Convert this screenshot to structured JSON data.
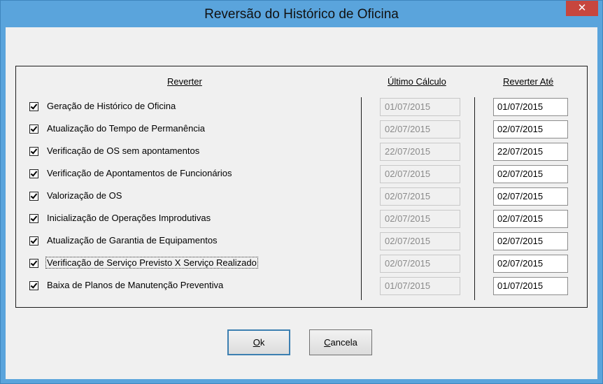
{
  "window": {
    "title": "Reversão do Histórico de Oficina",
    "close_label": "✕"
  },
  "columns": {
    "reverter": "Reverter",
    "ultimo_calculo": "Último Cálculo",
    "reverter_ate": "Reverter Até"
  },
  "rows": [
    {
      "label": "Geração de Histórico de Oficina",
      "checked": true,
      "ultimo_calculo": "01/07/2015",
      "reverter_ate": "01/07/2015"
    },
    {
      "label": "Atualização do Tempo de Permanência",
      "checked": true,
      "ultimo_calculo": "02/07/2015",
      "reverter_ate": "02/07/2015"
    },
    {
      "label": "Verificação de OS sem apontamentos",
      "checked": true,
      "ultimo_calculo": "22/07/2015",
      "reverter_ate": "22/07/2015"
    },
    {
      "label": "Verificação de Apontamentos de Funcionários",
      "checked": true,
      "ultimo_calculo": "02/07/2015",
      "reverter_ate": "02/07/2015"
    },
    {
      "label": "Valorização de OS",
      "checked": true,
      "ultimo_calculo": "02/07/2015",
      "reverter_ate": "02/07/2015"
    },
    {
      "label": "Inicialização de Operações Improdutivas",
      "checked": true,
      "ultimo_calculo": "02/07/2015",
      "reverter_ate": "02/07/2015"
    },
    {
      "label": "Atualização de Garantia de Equipamentos",
      "checked": true,
      "ultimo_calculo": "02/07/2015",
      "reverter_ate": "02/07/2015"
    },
    {
      "label": "Verificação de Serviço Previsto X Serviço Realizado",
      "checked": true,
      "ultimo_calculo": "02/07/2015",
      "reverter_ate": "02/07/2015"
    },
    {
      "label": "Baixa de Planos de Manutenção Preventiva",
      "checked": true,
      "ultimo_calculo": "01/07/2015",
      "reverter_ate": "01/07/2015"
    }
  ],
  "buttons": {
    "ok": {
      "mnemonic": "O",
      "rest": "k"
    },
    "cancel": {
      "mnemonic": "C",
      "rest": "ancela"
    }
  },
  "colors": {
    "title_bar": "#5aa4dc",
    "close": "#c7463e",
    "dialog": "#f0f0f0"
  },
  "icons": {
    "close": "close-icon",
    "checkbox": "checkmark-icon"
  }
}
